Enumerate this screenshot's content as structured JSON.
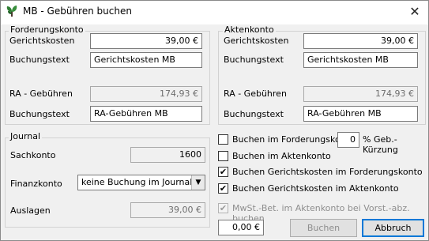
{
  "window": {
    "title": "MB - Gebühren buchen",
    "icon": "plant-icon",
    "close": "✕"
  },
  "forderungskonto": {
    "legend": "Forderungskonto",
    "gk_label": "Gerichtskosten",
    "gk_value": "39,00 €",
    "bt1_label": "Buchungstext",
    "bt1_value": "Gerichtskosten MB",
    "ra_label": "RA - Gebühren",
    "ra_value": "174,93 €",
    "bt2_label": "Buchungstext",
    "bt2_value": "RA-Gebühren MB"
  },
  "aktenkonto": {
    "legend": "Aktenkonto",
    "gk_label": "Gerichtskosten",
    "gk_value": "39,00 €",
    "bt1_label": "Buchungstext",
    "bt1_value": "Gerichtskosten MB",
    "ra_label": "RA - Gebühren",
    "ra_value": "174,93 €",
    "bt2_label": "Buchungstext",
    "bt2_value": "RA-Gebühren MB"
  },
  "journal": {
    "legend": "Journal",
    "sachkonto_label": "Sachkonto",
    "sachkonto_value": "1600",
    "finanzkonto_label": "Finanzkonto",
    "finanzkonto_value": "keine Buchung im Journal",
    "auslagen_label": "Auslagen",
    "auslagen_value": "39,00 €"
  },
  "options": {
    "opt1": {
      "label": "Buchen im Forderungskonto",
      "checked": false
    },
    "kuerzung_value": "0",
    "kuerzung_label": "% Geb.-Kürzung",
    "opt2": {
      "label": "Buchen im Aktenkonto",
      "checked": false
    },
    "opt3": {
      "label": "Buchen Gerichtskosten im Forderungskonto",
      "checked": true
    },
    "opt4": {
      "label": "Buchen Gerichtskosten im Aktenkonto",
      "checked": true
    },
    "opt5": {
      "label": "MwSt.-Bet. im Aktenkonto bei Vorst.-abz. buchen",
      "checked": true,
      "disabled": true
    }
  },
  "footer": {
    "amount": "0,00 €",
    "buchen_label": "Buchen",
    "abbruch_label": "Abbruch"
  },
  "colors": {
    "focus": "#0078d7",
    "icon": "#2e7d32"
  }
}
